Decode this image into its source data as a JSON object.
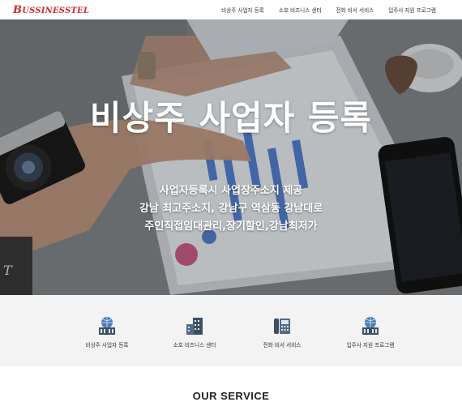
{
  "header": {
    "logo_first": "B",
    "logo_rest": "USSINESSTEL",
    "nav": [
      {
        "label": "비상주 사업자 등록"
      },
      {
        "label": "소호 비즈니스 센터"
      },
      {
        "label": "전화 비서 서비스"
      },
      {
        "label": "입주사 지원 프로그램"
      }
    ]
  },
  "hero": {
    "title": "비상주 사업자 등록",
    "lines": [
      "사업자등록시 사업장주소지 제공",
      "강남 최고주소지, 강남구 역삼동 강남대로",
      "주인직접임대관리,장기할인,강남최저가"
    ]
  },
  "services": [
    {
      "label": "비상주 사업자 등록",
      "icon": "globe-building-icon"
    },
    {
      "label": "소호 비즈니스 센터",
      "icon": "office-building-icon"
    },
    {
      "label": "전화 비서 서비스",
      "icon": "telephone-icon"
    },
    {
      "label": "입주사 지원 프로그램",
      "icon": "globe-building-icon"
    }
  ],
  "section_title": "OUR SERVICE",
  "colors": {
    "logo": "#cf2b2b",
    "services_bg": "#f3f3f3",
    "icon": "#3d4f63"
  }
}
